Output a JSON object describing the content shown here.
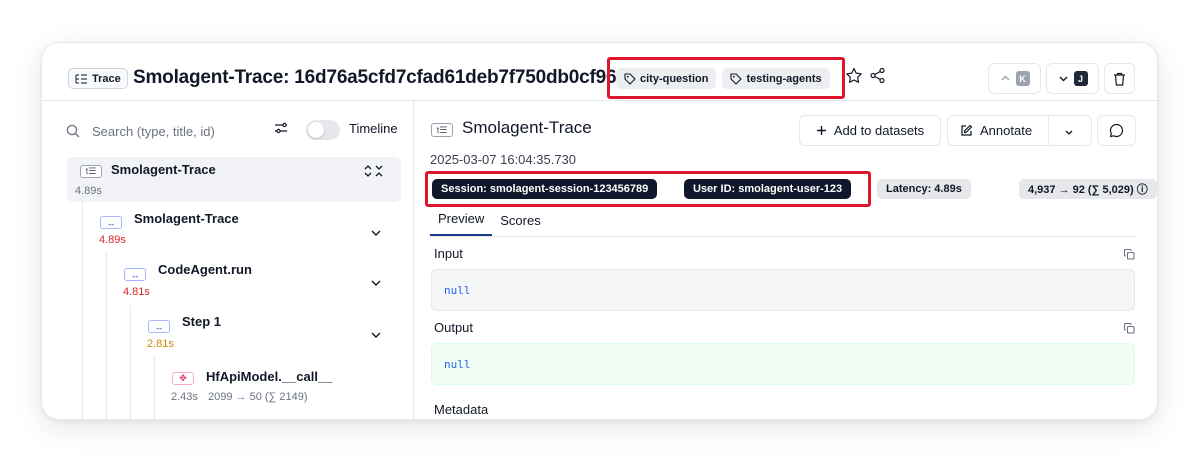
{
  "header": {
    "badge_label": "Trace",
    "title": "Smolagent-Trace: 16d76a5cfd7cfad61deb7f750db0cf96",
    "tags": [
      "city-question",
      "testing-agents"
    ],
    "prev_key": "K",
    "next_key": "J"
  },
  "sidebar": {
    "search_placeholder": "Search (type, title, id)",
    "timeline_label": "Timeline",
    "nodes": [
      {
        "badge": "t☰",
        "title": "Smolagent-Trace",
        "time": "4.89s"
      },
      {
        "badge": "↔",
        "title": "Smolagent-Trace",
        "time": "4.89s"
      },
      {
        "badge": "↔",
        "title": "CodeAgent.run",
        "time": "4.81s"
      },
      {
        "badge": "↔",
        "title": "Step 1",
        "time": "2.81s"
      },
      {
        "badge": "✥",
        "title": "HfApiModel.__call__",
        "time": "2.43s",
        "tokens": "2099 → 50 (∑ 2149)"
      }
    ]
  },
  "detail": {
    "badge": "t☰",
    "title": "Smolagent-Trace",
    "timestamp": "2025-03-07 16:04:35.730",
    "add_to_datasets": "Add to datasets",
    "annotate": "Annotate",
    "session": "Session: smolagent-session-123456789",
    "user_id": "User ID: smolagent-user-123",
    "latency": "Latency: 4.89s",
    "tokens": "4,937 → 92 (∑ 5,029) ⓘ",
    "tabs": [
      "Preview",
      "Scores"
    ],
    "input_label": "Input",
    "input_value": "null",
    "output_label": "Output",
    "output_value": "null",
    "metadata_label": "Metadata"
  },
  "colors": {
    "highlight": "#e0162d",
    "timing_red": "#dc2626",
    "timing_amber": "#ca8a04",
    "active_tab": "#1e3a8a"
  }
}
